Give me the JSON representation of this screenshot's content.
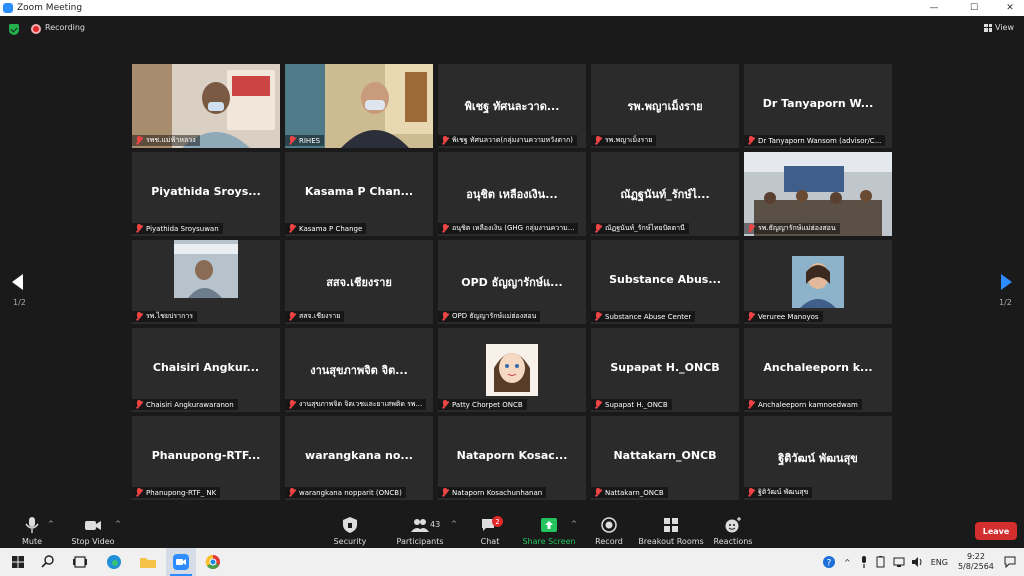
{
  "window": {
    "title": "Zoom Meeting"
  },
  "status": {
    "recording_label": "Recording",
    "view_label": "View"
  },
  "pagination": {
    "left": "1/2",
    "right": "1/2"
  },
  "tiles": [
    {
      "id": "t0",
      "big": "",
      "name": "รพช.แม่ฟ้าหลวง",
      "video": true
    },
    {
      "id": "t1",
      "big": "",
      "name": "RIHES",
      "video": true,
      "active": true
    },
    {
      "id": "t2",
      "big": "พิเชฐ ทัศนละวาด...",
      "name": "พิเชฐ ทัศนลวาด(กลุ่มงานความหวังตาก)"
    },
    {
      "id": "t3",
      "big": "รพ.พญาเม็งราย",
      "name": "รพ.พญาเม็งราย"
    },
    {
      "id": "t4",
      "big": "Dr Tanyaporn W...",
      "name": "Dr Tanyaporn Wansom (advisor/C..."
    },
    {
      "id": "t5",
      "big": "Piyathida Sroys...",
      "name": "Piyathida Sroysuwan"
    },
    {
      "id": "t6",
      "big": "Kasama P Chan...",
      "name": "Kasama P Change"
    },
    {
      "id": "t7",
      "big": "อนุชิต เหลืองเงิน...",
      "name": "อนุชิต เหลืองเงิน (GHG กลุ่มงานความ..."
    },
    {
      "id": "t8",
      "big": "ณัฏฐนันท์_รักษ์ไ...",
      "name": "ณัฏฐนันท์_รักษ์ไทยปัตตานี"
    },
    {
      "id": "t9",
      "big": "",
      "name": "รพ.ธัญญารักษ์แม่ฮ่องสอน",
      "video": true
    },
    {
      "id": "t10",
      "big": "",
      "name": "รพ.ไชยปราการ",
      "video": true
    },
    {
      "id": "t11",
      "big": "สสจ.เชียงราย",
      "name": "สสจ.เชียงราย"
    },
    {
      "id": "t12",
      "big": "OPD ธัญญารักษ์แ...",
      "name": "OPD ธัญญารักษ์แม่ฮ่องสอน"
    },
    {
      "id": "t13",
      "big": "Substance Abus...",
      "name": "Substance Abuse Center"
    },
    {
      "id": "t14",
      "big": "",
      "name": "Veruree Manoyos",
      "video": true
    },
    {
      "id": "t15",
      "big": "Chaisiri Angkur...",
      "name": "Chaisiri Angkurawaranon"
    },
    {
      "id": "t16",
      "big": "งานสุขภาพจิต จิต...",
      "name": "งานสุขภาพจิต จิตเวชและยาเสพติด รพ..."
    },
    {
      "id": "t17",
      "big": "",
      "name": "Patty Chorpet ONCB",
      "video": true
    },
    {
      "id": "t18",
      "big": "Supapat H._ONCB",
      "name": "Supapat H._ONCB"
    },
    {
      "id": "t19",
      "big": "Anchaleeporn k...",
      "name": "Anchaleeporn kamnoedwam"
    },
    {
      "id": "t20",
      "big": "Phanupong-RTF...",
      "name": "Phanupong-RTF_ NK"
    },
    {
      "id": "t21",
      "big": "warangkana no...",
      "name": "warangkana nopparit (ONCB)"
    },
    {
      "id": "t22",
      "big": "Nataporn Kosac...",
      "name": "Nataporn Kosachunhanan"
    },
    {
      "id": "t23",
      "big": "Nattakarn_ONCB",
      "name": "Nattakarn_ONCB"
    },
    {
      "id": "t24",
      "big": "ฐิติวัฒน์ พัฒนสุข",
      "name": "ฐิติวัฒน์ พัฒนสุข"
    }
  ],
  "toolbar": {
    "mute": "Mute",
    "video": "Stop Video",
    "security": "Security",
    "participants": "Participants",
    "participants_count": "43",
    "chat": "Chat",
    "chat_badge": "2",
    "share": "Share Screen",
    "record": "Record",
    "breakout": "Breakout Rooms",
    "reactions": "Reactions",
    "leave": "Leave"
  },
  "colors": {
    "share_accent": "#23c35e",
    "leave_red": "#d32f2f",
    "active_border": "#cde62c"
  },
  "taskbar": {
    "lang": "ENG",
    "time": "9:22",
    "date": "5/8/2564"
  }
}
